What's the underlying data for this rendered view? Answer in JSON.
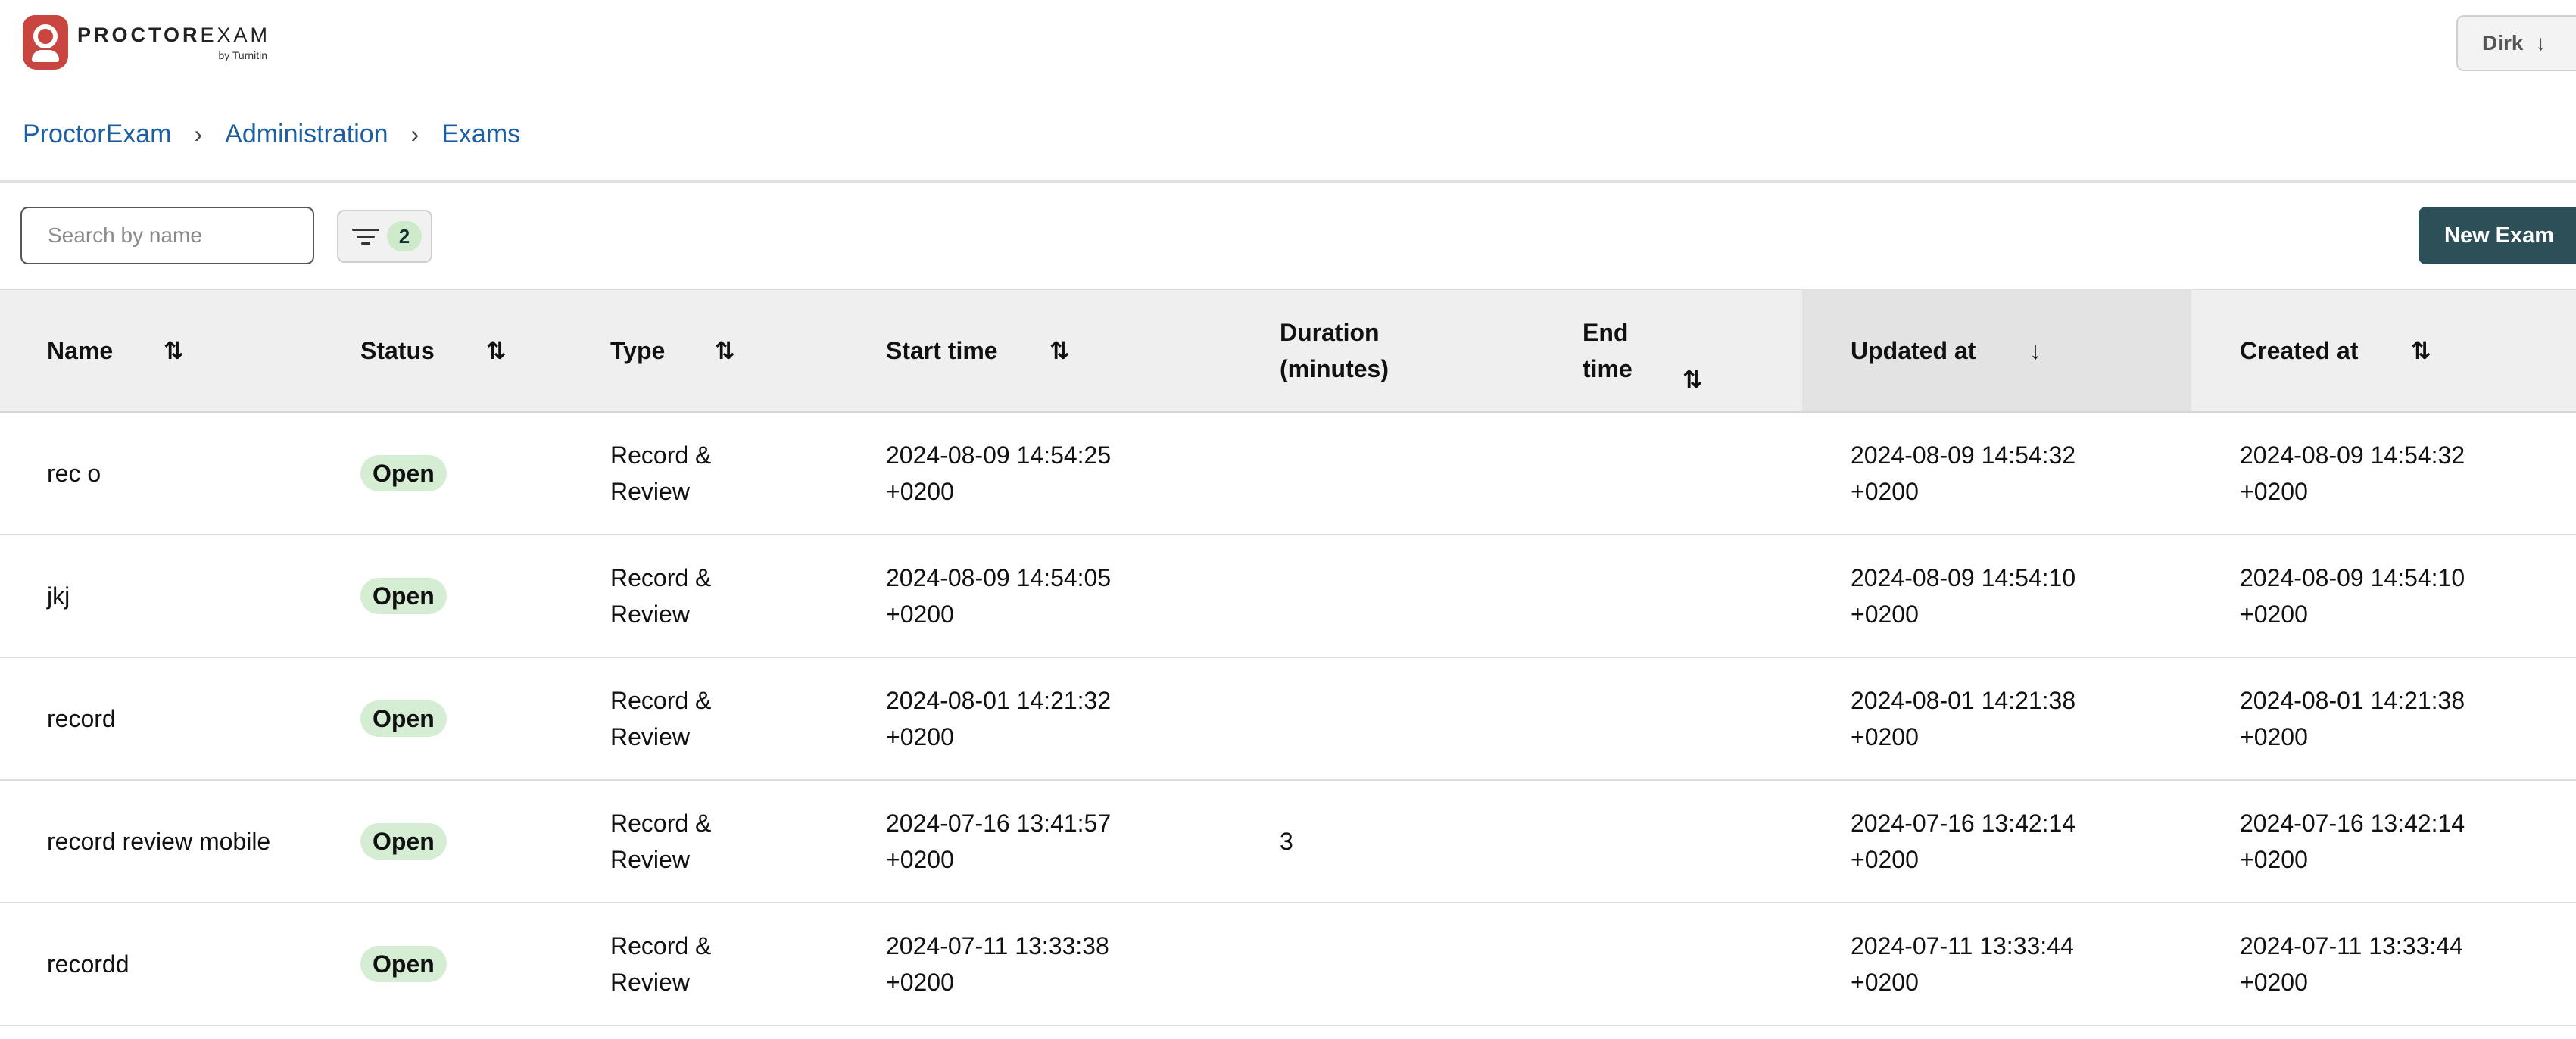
{
  "brand": {
    "logo_word_bold": "PROCTOR",
    "logo_word_light": "EXAM",
    "logo_sub": "by Turnitin",
    "brand_color": "#c8463f"
  },
  "user_menu": {
    "name": "Dirk",
    "arrow": "↓"
  },
  "breadcrumb": {
    "items": [
      "ProctorExam",
      "Administration",
      "Exams"
    ],
    "separator": "›"
  },
  "toolbar": {
    "search_placeholder": "Search by name",
    "filter_count": "2",
    "new_exam_label": "New Exam",
    "new_exam_color": "#2d4f58"
  },
  "table": {
    "columns": [
      {
        "label": "Name",
        "sort": "⇅"
      },
      {
        "label": "Status",
        "sort": "⇅"
      },
      {
        "label": "Type",
        "sort": "⇅"
      },
      {
        "label": "Start time",
        "sort": "⇅"
      },
      {
        "label_line1": "Duration",
        "label_line2": "(minutes)"
      },
      {
        "label_line1": "End",
        "label_line2": "time",
        "sort": "⇅"
      },
      {
        "label": "Updated at",
        "sort": "↓"
      },
      {
        "label": "Created at",
        "sort": "⇅"
      }
    ],
    "rows": [
      {
        "name": "rec o",
        "status": "Open",
        "type": "Record & Review",
        "start": "2024-08-09 14:54:25 +0200",
        "duration": "",
        "end": "",
        "updated": "2024-08-09 14:54:32 +0200",
        "created": "2024-08-09 14:54:32 +0200"
      },
      {
        "name": "jkj",
        "status": "Open",
        "type": "Record & Review",
        "start": "2024-08-09 14:54:05 +0200",
        "duration": "",
        "end": "",
        "updated": "2024-08-09 14:54:10 +0200",
        "created": "2024-08-09 14:54:10 +0200"
      },
      {
        "name": "record",
        "status": "Open",
        "type": "Record & Review",
        "start": "2024-08-01 14:21:32 +0200",
        "duration": "",
        "end": "",
        "updated": "2024-08-01 14:21:38 +0200",
        "created": "2024-08-01 14:21:38 +0200"
      },
      {
        "name": "record review mobile",
        "status": "Open",
        "type": "Record & Review",
        "start": "2024-07-16 13:41:57 +0200",
        "duration": "3",
        "end": "",
        "updated": "2024-07-16 13:42:14 +0200",
        "created": "2024-07-16 13:42:14 +0200"
      },
      {
        "name": "recordd",
        "status": "Open",
        "type": "Record & Review",
        "start": "2024-07-11 13:33:38 +0200",
        "duration": "",
        "end": "",
        "updated": "2024-07-11 13:33:44 +0200",
        "created": "2024-07-11 13:33:44 +0200"
      }
    ]
  }
}
